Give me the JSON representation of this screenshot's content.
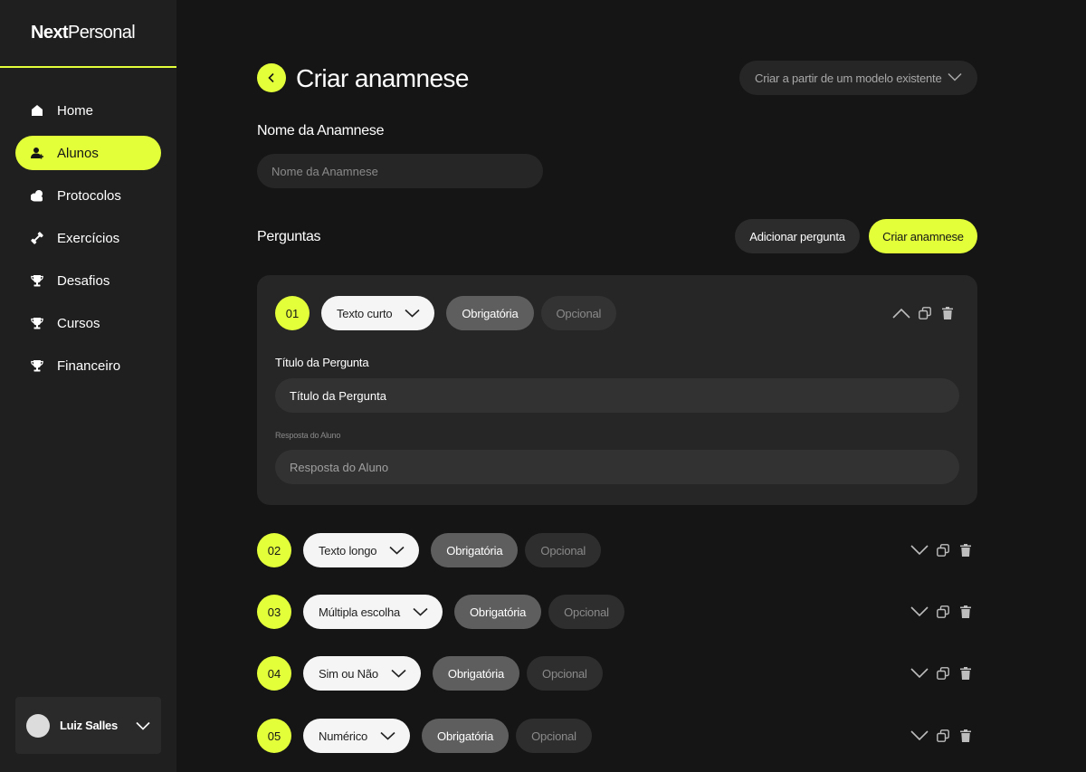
{
  "brand": {
    "part1": "Next",
    "part2": "Personal"
  },
  "sidebar": {
    "items": [
      {
        "label": "Home",
        "icon": "home-icon"
      },
      {
        "label": "Alunos",
        "icon": "user-add-icon",
        "active": true
      },
      {
        "label": "Protocolos",
        "icon": "protocol-icon"
      },
      {
        "label": "Exercícios",
        "icon": "dumbbell-icon"
      },
      {
        "label": "Desafios",
        "icon": "trophy-icon"
      },
      {
        "label": "Cursos",
        "icon": "trophy-icon"
      },
      {
        "label": "Financeiro",
        "icon": "trophy-icon"
      }
    ],
    "user": {
      "name": "Luiz Salles"
    }
  },
  "header": {
    "title": "Criar anamnese",
    "template_select": "Criar a partir de um modelo existente"
  },
  "form": {
    "name_label": "Nome da Anamnese",
    "name_placeholder": "Nome da Anamnese"
  },
  "questions": {
    "heading": "Perguntas",
    "add_button": "Adicionar pergunta",
    "create_button": "Criar anamnese",
    "expanded": {
      "title_label": "Título da Pergunta",
      "title_value": "Título da Pergunta",
      "answer_label": "Resposta do Aluno",
      "answer_placeholder": "Resposta do Aluno"
    },
    "items": [
      {
        "number": "01",
        "type": "Texto curto",
        "required": "Obrigatória",
        "optional": "Opcional"
      },
      {
        "number": "02",
        "type": "Texto longo",
        "required": "Obrigatória",
        "optional": "Opcional"
      },
      {
        "number": "03",
        "type": "Múltipla escolha",
        "required": "Obrigatória",
        "optional": "Opcional"
      },
      {
        "number": "04",
        "type": "Sim ou Não",
        "required": "Obrigatória",
        "optional": "Opcional"
      },
      {
        "number": "05",
        "type": "Numérico",
        "required": "Obrigatória",
        "optional": "Opcional"
      }
    ]
  },
  "colors": {
    "accent": "#e2ff3a",
    "background": "#151515",
    "sidebar": "#1f1f1f",
    "card": "#262626"
  }
}
